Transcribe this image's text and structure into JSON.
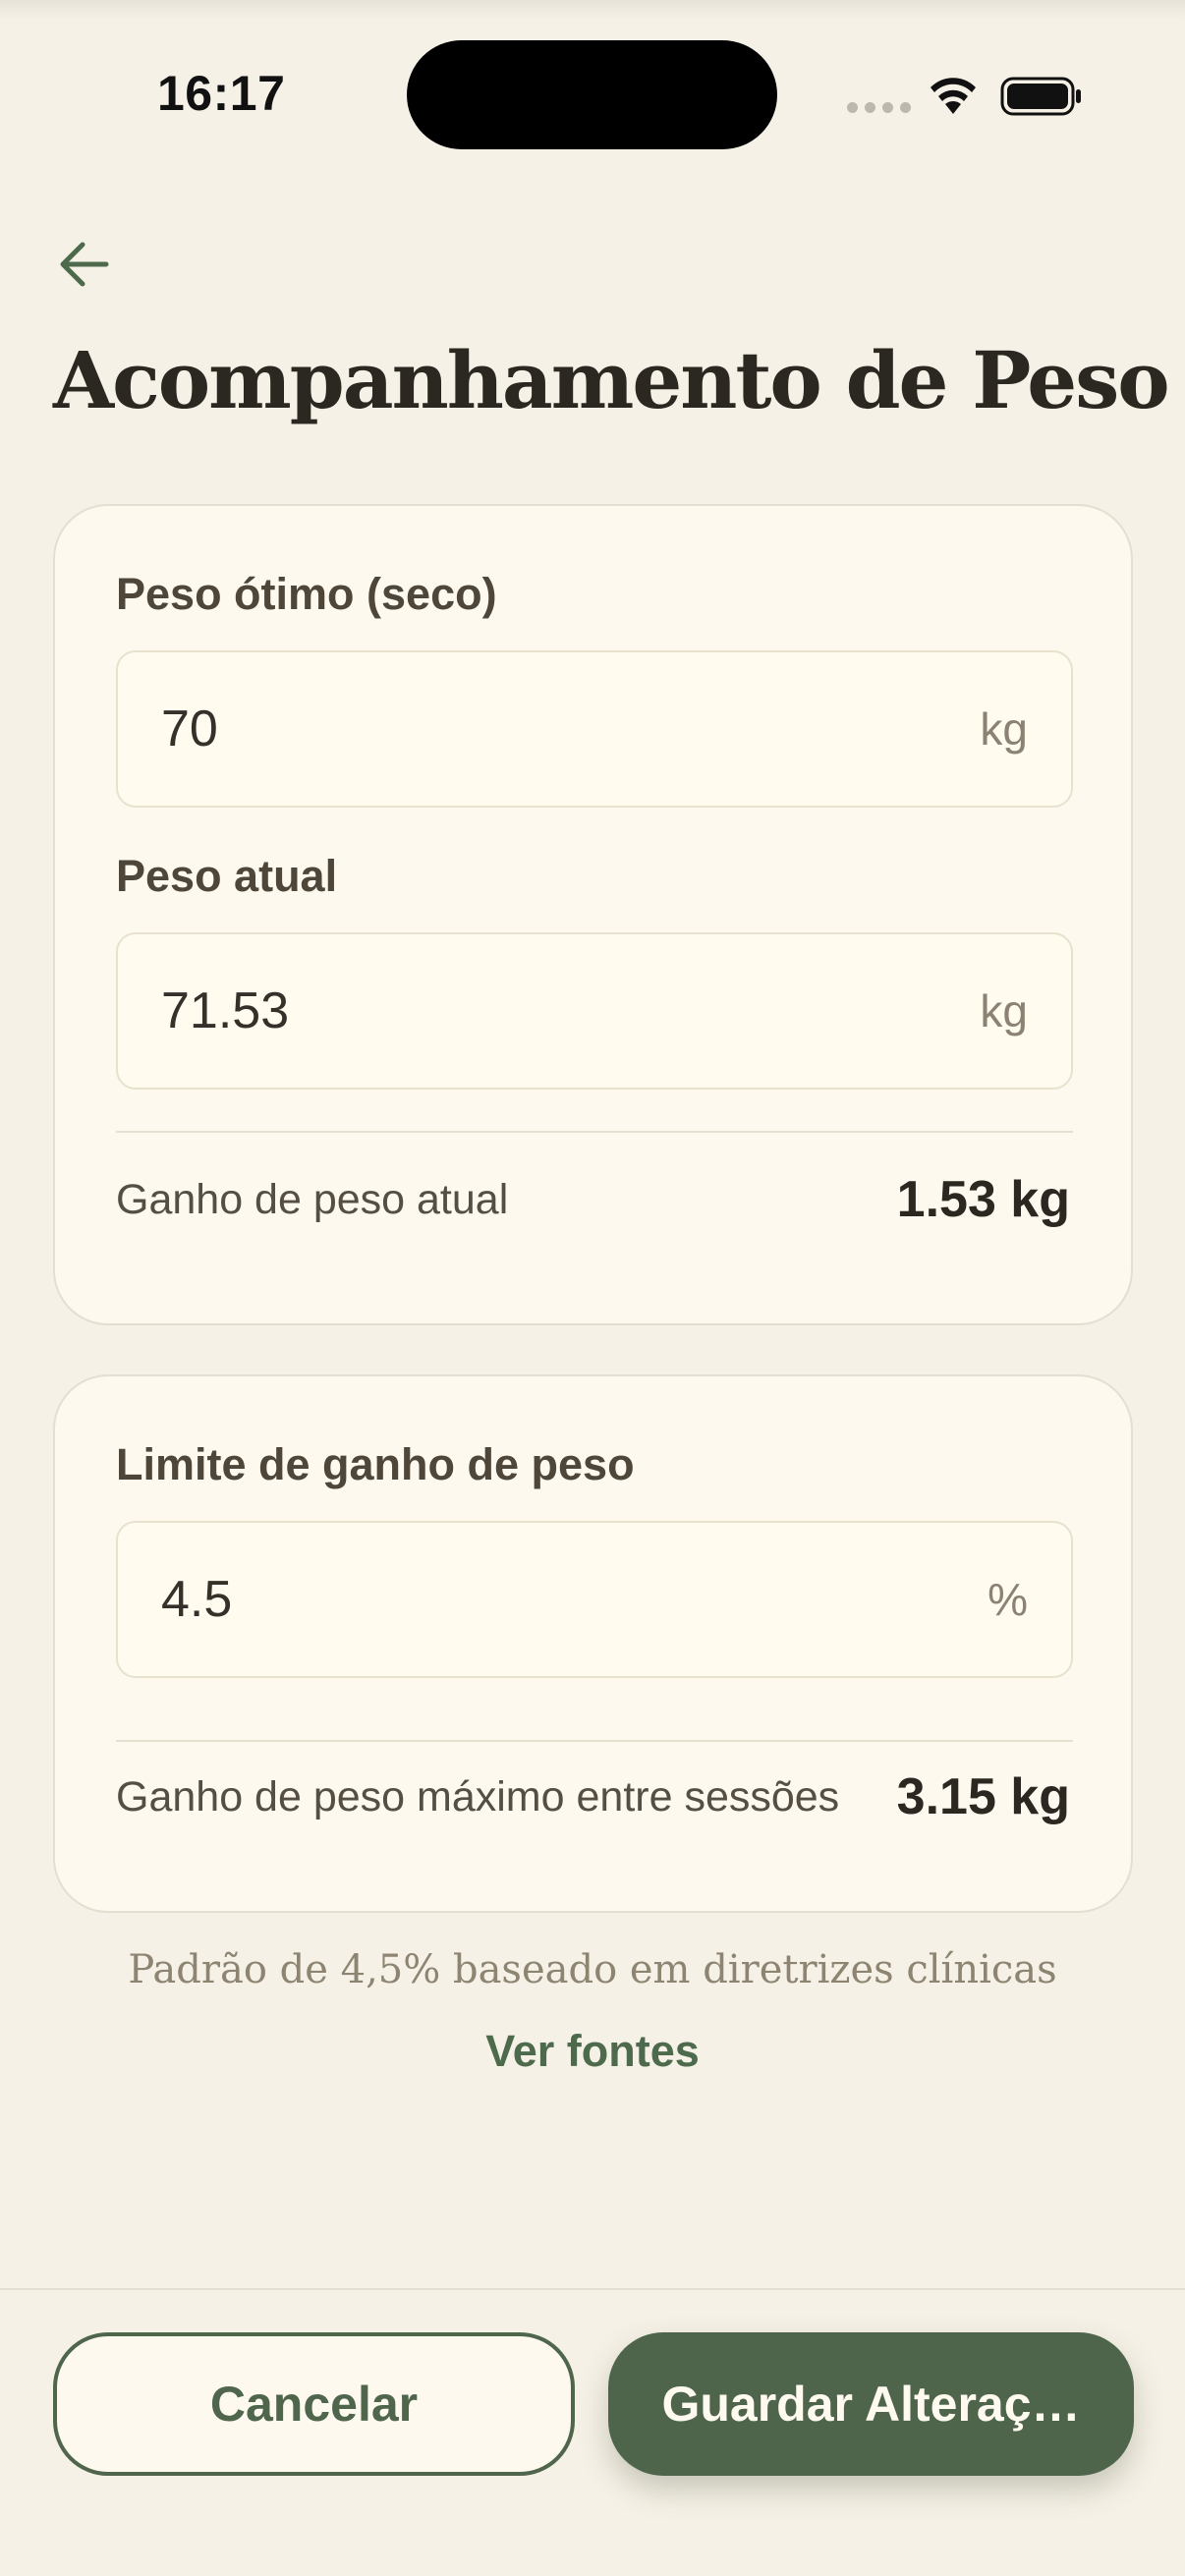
{
  "status_bar": {
    "time": "16:17",
    "icons": [
      "signal-dots-icon",
      "wifi-icon",
      "battery-icon"
    ]
  },
  "header": {
    "back_icon": "arrow-left-icon",
    "title": "Acompanhamento de Peso"
  },
  "weight_card": {
    "optimal_label": "Peso ótimo (seco)",
    "optimal_value": "70",
    "optimal_unit": "kg",
    "current_label": "Peso atual",
    "current_value": "71.53",
    "current_unit": "kg",
    "gain_label": "Ganho de peso atual",
    "gain_value": "1.53 kg"
  },
  "limit_card": {
    "limit_label": "Limite de ganho de peso",
    "limit_value": "4.5",
    "limit_unit": "%",
    "max_gain_label": "Ganho de peso máximo entre sessões",
    "max_gain_value": "3.15 kg"
  },
  "footer": {
    "hint": "Padrão de 4,5% baseado em diretrizes clínicas",
    "sources_link": "Ver fontes"
  },
  "actions": {
    "cancel_label": "Cancelar",
    "save_label": "Guardar Alteraç…"
  },
  "colors": {
    "background": "#f6f1e6",
    "card": "#fdf9ef",
    "accent_green": "#4e654b",
    "text_dark": "#2b2721"
  }
}
